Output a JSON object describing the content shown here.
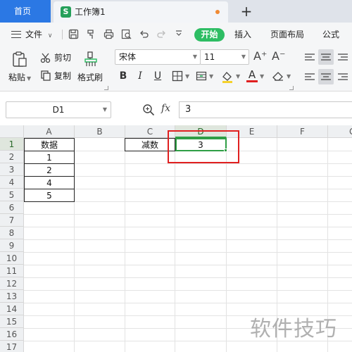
{
  "tabs": {
    "home": "首页",
    "doc_icon": "S",
    "doc_title": "工作簿1",
    "add": "+"
  },
  "menu": {
    "file": "文件",
    "items": [
      "开始",
      "插入",
      "页面布局",
      "公式"
    ],
    "icons": [
      "save-icon",
      "format-painter-icon",
      "print-icon",
      "print-preview-icon",
      "undo-icon",
      "redo-icon",
      "more-icon"
    ]
  },
  "ribbon": {
    "paste": "粘贴",
    "cut": "剪切",
    "copy": "复制",
    "format_painter": "格式刷",
    "font_name": "宋体",
    "font_size": "11",
    "bold": "B",
    "italic": "I",
    "underline": "U",
    "font_color_letter": "A",
    "grow_font": "A⁺",
    "shrink_font": "A⁻"
  },
  "formula_bar": {
    "name_box": "D1",
    "fx": "fx",
    "value": "3"
  },
  "grid": {
    "columns": [
      "A",
      "B",
      "C",
      "D",
      "E",
      "F",
      "G"
    ],
    "rows": [
      "1",
      "2",
      "3",
      "4",
      "5",
      "6",
      "7",
      "8",
      "9",
      "10",
      "11",
      "12",
      "13",
      "14",
      "15",
      "16",
      "17"
    ],
    "selected_col": "D",
    "selected_row": "1",
    "cells": {
      "A1": "数据",
      "A2": "1",
      "A3": "2",
      "A4": "4",
      "A5": "5",
      "C1": "减数",
      "D1": "3"
    }
  },
  "watermark": "软件技巧",
  "colors": {
    "accent_blue": "#2b78e4",
    "accent_green": "#2dbd63",
    "selection": "#2f9e45",
    "highlight_red": "#e02020"
  }
}
